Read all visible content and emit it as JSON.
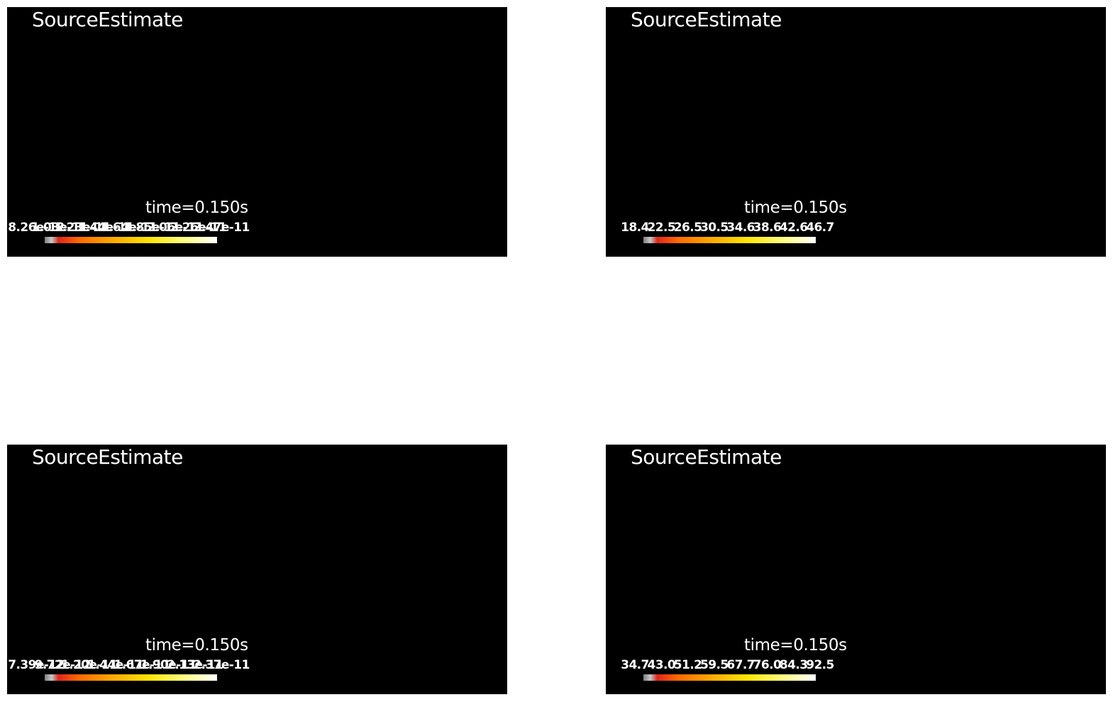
{
  "panels": [
    {
      "title": "SourceEstimate",
      "time_label": "time=0.150s",
      "colorbar_ticks": [
        "8.26e-12",
        "1.03e-11",
        "1.23e-11",
        "1.44e-11",
        "1.64e-11",
        "1.85e-11",
        "2.06e-11",
        "2.26e-11",
        "2.47e-11"
      ],
      "colormap": "hot"
    },
    {
      "title": "SourceEstimate",
      "time_label": "time=0.150s",
      "colorbar_ticks": [
        "18.4",
        "22.5",
        "26.5",
        "30.5",
        "34.6",
        "38.6",
        "42.6",
        "46.7"
      ],
      "colormap": "hot"
    },
    {
      "title": "SourceEstimate",
      "time_label": "time=0.150s",
      "colorbar_ticks": [
        "7.39e-12",
        "9.72e-12",
        "1.20e-11",
        "1.44e-11",
        "1.67e-11",
        "1.90e-11",
        "2.13e-11",
        "2.37e-11"
      ],
      "colormap": "hot"
    },
    {
      "title": "SourceEstimate",
      "time_label": "time=0.150s",
      "colorbar_ticks": [
        "34.7",
        "43.0",
        "51.2",
        "59.5",
        "67.7",
        "76.0",
        "84.3",
        "92.5"
      ],
      "colormap": "hot"
    }
  ]
}
